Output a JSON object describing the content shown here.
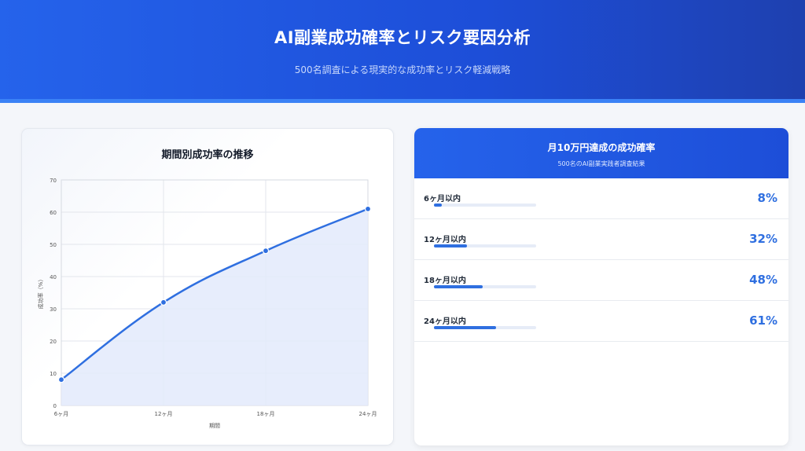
{
  "header": {
    "title": "AI副業成功確率とリスク要因分析",
    "subtitle": "500名調査による現実的な成功率とリスク軽減戦略"
  },
  "chart_data": {
    "type": "line",
    "title": "期間別成功率の推移",
    "xlabel": "期間",
    "ylabel": "成功率（%）",
    "categories": [
      "6ヶ月",
      "12ヶ月",
      "18ヶ月",
      "24ヶ月"
    ],
    "series": [
      {
        "values": [
          8,
          32,
          48,
          61
        ]
      }
    ],
    "ylim": [
      0,
      70
    ],
    "yticks": [
      0,
      10,
      20,
      30,
      40,
      50,
      60,
      70
    ],
    "grid": true,
    "fill": true,
    "line_color": "#2f6fe0",
    "fill_color": "#e3eafb"
  },
  "panel": {
    "title": "月10万円達成の成功確率",
    "subtitle": "500名のAI副業実践者調査結果",
    "rows": [
      {
        "label": "6ヶ月以内",
        "value": "8%",
        "fraction": 0.08
      },
      {
        "label": "12ヶ月以内",
        "value": "32%",
        "fraction": 0.32
      },
      {
        "label": "18ヶ月以内",
        "value": "48%",
        "fraction": 0.48
      },
      {
        "label": "24ヶ月以内",
        "value": "61%",
        "fraction": 0.61
      }
    ]
  },
  "colors": {
    "accent": "#2563eb",
    "bar": "#2f6fe0",
    "track": "#e6ecf7"
  }
}
